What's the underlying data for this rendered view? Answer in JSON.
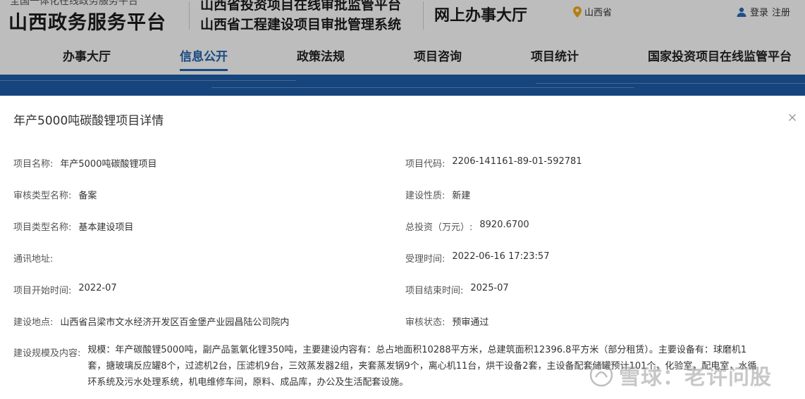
{
  "header": {
    "brand_sub": "全国一体化在线政务服务平台",
    "brand_main": "山西政务服务平台",
    "system_line1": "山西省投资项目在线审批监管平台",
    "system_line2": "山西省工程建设项目审批管理系统",
    "hall": "网上办事大厅",
    "location": "山西省",
    "login": "登录",
    "register": "注册",
    "pin_icon": "location-pin-icon",
    "user_icon": "user-icon"
  },
  "nav": {
    "items": [
      {
        "label": "办事大厅"
      },
      {
        "label": "信息公开",
        "active": true
      },
      {
        "label": "政策法规"
      },
      {
        "label": "项目咨询"
      },
      {
        "label": "项目统计"
      },
      {
        "label": "国家投资项目在线监管平台"
      }
    ]
  },
  "modal": {
    "title": "年产5000吨碳酸锂项目详情",
    "close_icon": "close-icon",
    "fields": {
      "project_name": {
        "label": "项目名称:",
        "value": "年产5000吨碳酸锂项目"
      },
      "project_code": {
        "label": "项目代码:",
        "value": "2206-141161-89-01-592781"
      },
      "review_type": {
        "label": "审核类型名称:",
        "value": "备案"
      },
      "nature": {
        "label": "建设性质:",
        "value": "新建"
      },
      "project_type": {
        "label": "项目类型名称:",
        "value": "基本建设项目"
      },
      "investment": {
        "label": "总投资（万元）:",
        "value": "8920.6700"
      },
      "address": {
        "label": "通讯地址:",
        "value": ""
      },
      "accept_time": {
        "label": "受理时间:",
        "value": "2022-06-16 17:23:57"
      },
      "start_time": {
        "label": "项目开始时间:",
        "value": "2022-07"
      },
      "end_time": {
        "label": "项目结束时间:",
        "value": "2025-07"
      },
      "location": {
        "label": "建设地点:",
        "value": "山西省吕梁市文水经济开发区百金堡产业园昌陆公司院内"
      },
      "status": {
        "label": "审核状态:",
        "value": "预审通过"
      },
      "scope": {
        "label": "建设规模及内容:",
        "value": "规模：年产碳酸锂5000吨，副产品氢氧化锂350吨，主要建设内容有：总占地面积10288平方米，总建筑面积12396.8平方米（部分租赁）。主要设备有：球磨机1套，搪玻璃反应罐8个，过滤机2台，压滤机9台，三效蒸发器2组，夹套蒸发锅9个，离心机11台，烘干设备2套，主设备配套储罐预计101个，化验室，配电室，水循环系统及污水处理系统，机电维修车间，原料、成品库，办公及生活配套设施。"
      }
    }
  },
  "watermark": {
    "text": "雪球：老许问股",
    "logo_icon": "snowball-logo-icon"
  },
  "colors": {
    "accent": "#1f5fa8",
    "banner": "#1d58a0",
    "header_bg": "#f2f2f2"
  }
}
